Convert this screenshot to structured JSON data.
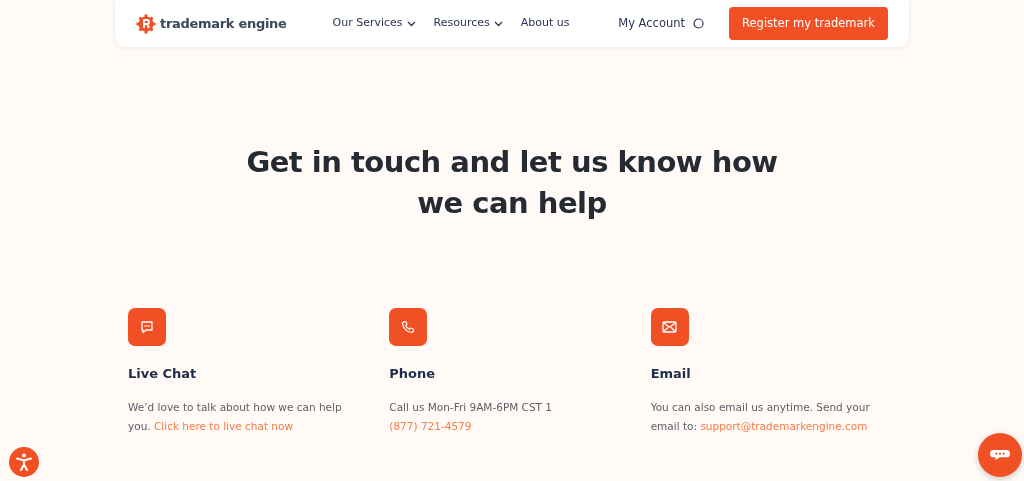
{
  "header": {
    "logo_text": "trademark engine",
    "menu": [
      {
        "label": "Our Services",
        "dropdown": true
      },
      {
        "label": "Resources",
        "dropdown": true
      },
      {
        "label": "About us",
        "dropdown": false
      }
    ],
    "account": "My Account",
    "cta": "Register my trademark"
  },
  "heading": "Get in touch and let us know how we can help",
  "contacts": [
    {
      "kind": "chat",
      "title": "Live Chat",
      "text": "We’d love to talk about how we can help you.",
      "link": "Click here to live chat now"
    },
    {
      "kind": "phone",
      "title": "Phone",
      "text": "Call us Mon-Fri 9AM-6PM CST 1",
      "link": "(877) 721-4579"
    },
    {
      "kind": "email",
      "title": "Email",
      "text": "You can also email us anytime. Send your email to:",
      "link": "support@trademarkengine.com"
    }
  ]
}
